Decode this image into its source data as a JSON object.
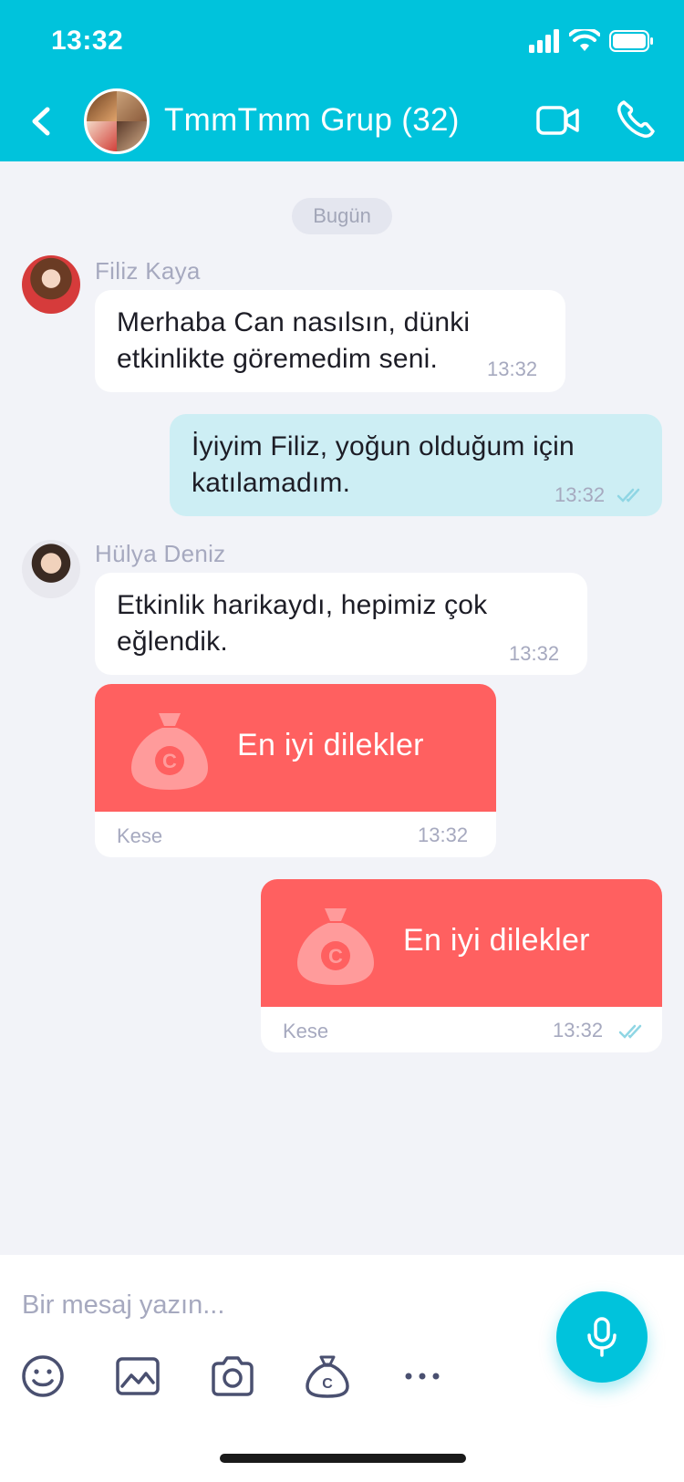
{
  "status_bar": {
    "time": "13:32"
  },
  "header": {
    "title": "TmmTmm Grup (32)"
  },
  "chat": {
    "date_label": "Bugün",
    "messages": [
      {
        "sender": "Filiz Kaya",
        "text_lines": [
          "Merhaba Can nasılsın, dünki",
          "etkinlikte göremedim seni."
        ],
        "time": "13:32"
      },
      {
        "sender": "me",
        "text_lines": [
          "İyiyim Filiz, yoğun olduğum için",
          "katılamadım."
        ],
        "time": "13:32"
      },
      {
        "sender": "Hülya Deniz",
        "text_lines": [
          "Etkinlik harikaydı, hepimiz çok",
          "eğlendik."
        ],
        "time": "13:32"
      }
    ],
    "gifts": [
      {
        "text": "En iyi dilekler",
        "label": "Kese",
        "time": "13:32"
      },
      {
        "text": "En iyi dilekler",
        "label": "Kese",
        "time": "13:32"
      }
    ]
  },
  "composer": {
    "placeholder": "Bir mesaj yazın..."
  },
  "colors": {
    "accent": "#00c3dc",
    "gift": "#ff6060",
    "outgoing": "#cdeef4"
  },
  "icons": [
    "back-arrow-icon",
    "video-call-icon",
    "phone-icon",
    "emoji-icon",
    "gallery-icon",
    "camera-icon",
    "money-bag-icon",
    "more-icon",
    "microphone-icon",
    "double-check-icon"
  ]
}
